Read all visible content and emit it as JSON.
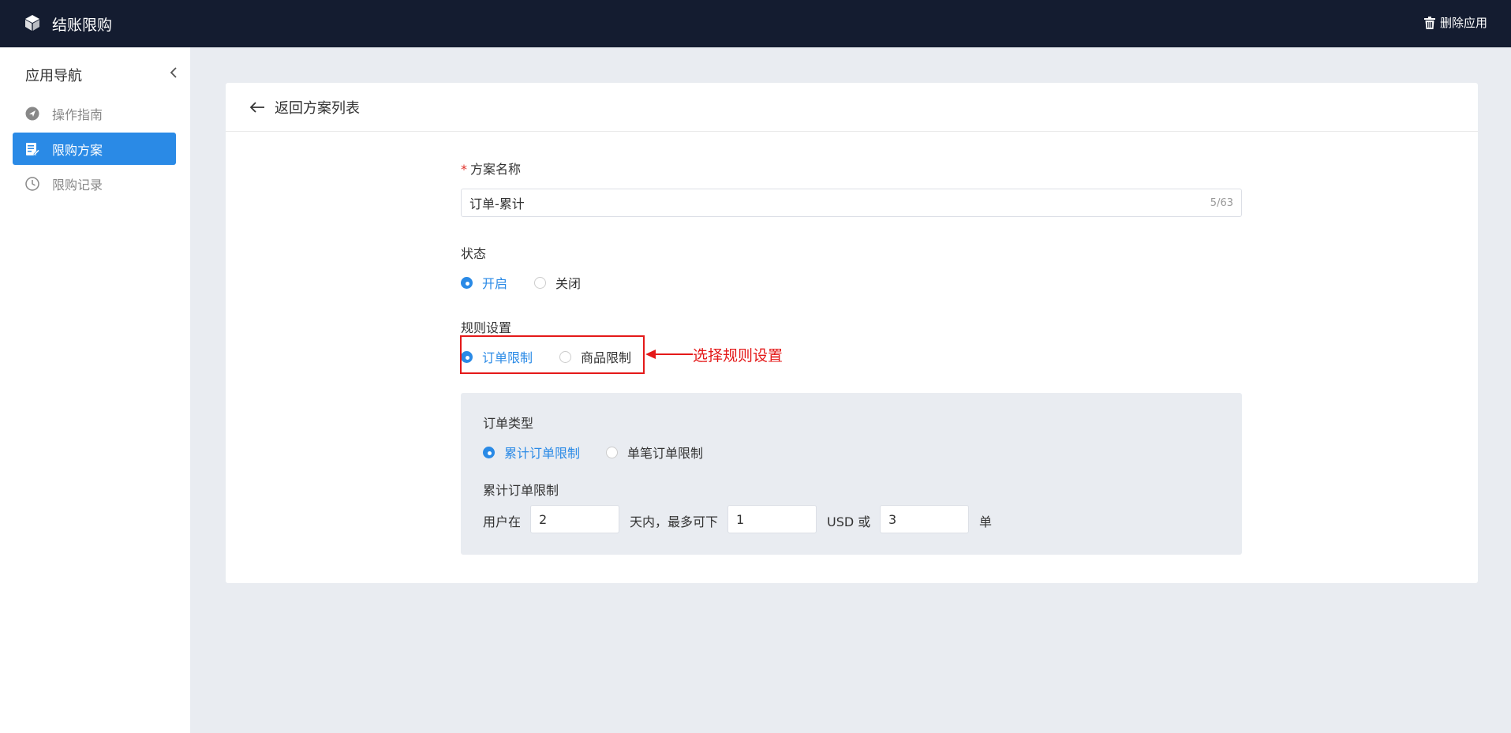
{
  "topbar": {
    "app_title": "结账限购",
    "delete_label": "删除应用"
  },
  "sidebar": {
    "header": "应用导航",
    "items": [
      {
        "label": "操作指南",
        "icon": "send-icon"
      },
      {
        "label": "限购方案",
        "icon": "edit-note-icon",
        "active": true
      },
      {
        "label": "限购记录",
        "icon": "clock-icon"
      }
    ]
  },
  "card": {
    "back_label": "返回方案列表"
  },
  "form": {
    "plan_name_label": "方案名称",
    "plan_name_value": "订单-累计",
    "plan_name_counter": "5/63",
    "status_label": "状态",
    "status_options": [
      "开启",
      "关闭"
    ],
    "status_selected": "开启",
    "rule_label": "规则设置",
    "rule_options": [
      "订单限制",
      "商品限制"
    ],
    "rule_selected": "订单限制",
    "order_type_label": "订单类型",
    "order_type_options": [
      "累计订单限制",
      "单笔订单限制"
    ],
    "order_type_selected": "累计订单限制",
    "cumulative_label": "累计订单限制",
    "cumulative_prefix": "用户在",
    "days_value": "2",
    "days_suffix": "天内，最多可下",
    "amount_value": "1",
    "amount_suffix": "USD 或",
    "count_value": "3",
    "count_suffix": "单"
  },
  "annotation": {
    "text": "选择规则设置",
    "color": "#e41919"
  },
  "colors": {
    "accent": "#2a8ae6",
    "topbar": "#141c30",
    "background": "#e9ecf1"
  }
}
